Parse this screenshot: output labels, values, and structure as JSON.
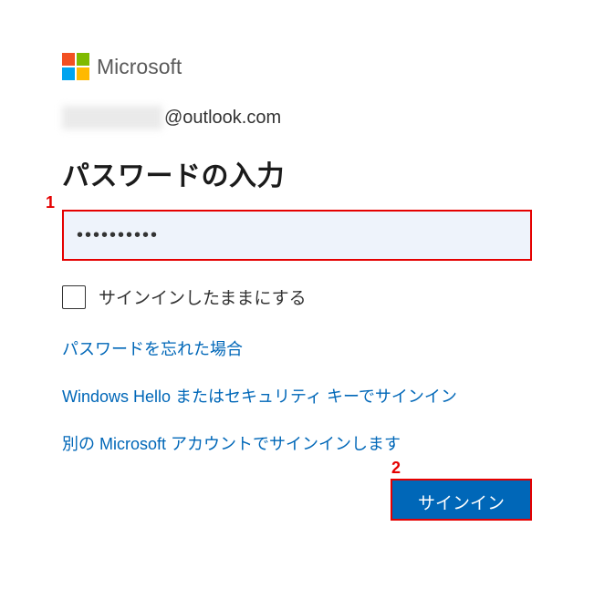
{
  "brand": {
    "name": "Microsoft"
  },
  "account": {
    "domain": "@outlook.com"
  },
  "heading": "パスワードの入力",
  "password": {
    "masked": "••••••••••"
  },
  "checkbox": {
    "label": "サインインしたままにする",
    "checked": false
  },
  "links": {
    "forgot": "パスワードを忘れた場合",
    "hello": "Windows Hello またはセキュリティ キーでサインイン",
    "other_account": "別の Microsoft アカウントでサインインします"
  },
  "button": {
    "signin": "サインイン"
  },
  "annotations": {
    "num1": "1",
    "num2": "2"
  }
}
